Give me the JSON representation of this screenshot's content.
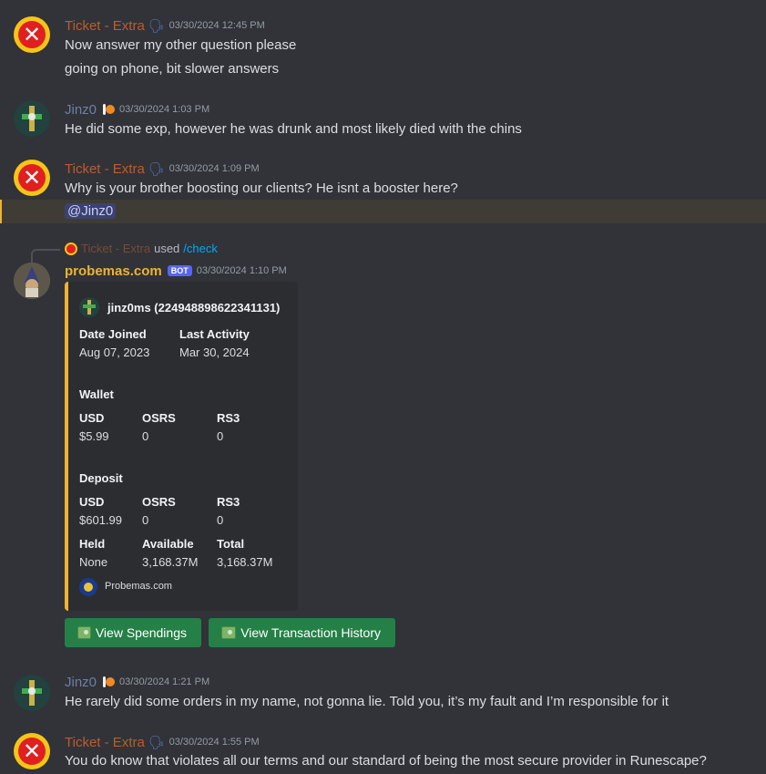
{
  "messages": [
    {
      "author": "Ticket - Extra",
      "timestamp": "03/30/2024 12:45 PM",
      "lines": [
        "Now answer my other question please",
        "going on phone, bit slower answers"
      ]
    },
    {
      "author": "Jinz0",
      "timestamp": "03/30/2024 1:03 PM",
      "lines": [
        "He did some exp, however he was drunk and most likely died with the chins"
      ]
    },
    {
      "author": "Ticket - Extra",
      "timestamp": "03/30/2024 1:09 PM",
      "lines": [
        "Why is your brother boosting our clients? He isnt a booster here?"
      ],
      "mention": "@Jinz0"
    },
    {
      "reply": {
        "user": "Ticket - Extra",
        "used": "used",
        "command": "/check"
      },
      "author": "probemas.com",
      "bot_tag": "BOT",
      "timestamp": "03/30/2024 1:10 PM",
      "embed": {
        "header": "jinz0ms (224948898622341131)",
        "date_joined_label": "Date Joined",
        "date_joined": "Aug 07, 2023",
        "last_activity_label": "Last Activity",
        "last_activity": "Mar 30, 2024",
        "wallet_title": "Wallet",
        "wallet": {
          "usd_label": "USD",
          "usd": "$5.99",
          "osrs_label": "OSRS",
          "osrs": "0",
          "rs3_label": "RS3",
          "rs3": "0"
        },
        "deposit_title": "Deposit",
        "deposit": {
          "usd_label": "USD",
          "usd": "$601.99",
          "osrs_label": "OSRS",
          "osrs": "0",
          "rs3_label": "RS3",
          "rs3": "0"
        },
        "held_label": "Held",
        "held": "None",
        "available_label": "Available",
        "available": "3,168.37M",
        "total_label": "Total",
        "total": "3,168.37M",
        "footer": "Probemas.com"
      },
      "buttons": [
        "View Spendings",
        "View Transaction History"
      ]
    },
    {
      "author": "Jinz0",
      "timestamp": "03/30/2024 1:21 PM",
      "lines": [
        "He rarely did some orders in my name, not gonna lie. Told you, it’s my fault and I’m responsible for it"
      ]
    },
    {
      "author": "Ticket - Extra",
      "timestamp": "03/30/2024 1:55 PM",
      "lines": [
        "You do know that violates all our terms and our standard of being the most secure provider in Runescape?"
      ]
    }
  ],
  "colors": {
    "background": "#313338",
    "ticket_name": "#c15a2a",
    "jinz_name": "#6f7ea8",
    "bot_name": "#f0b232",
    "button": "#248046",
    "mention_bg": "#3c4270",
    "highlight_bg": "#3f3c35"
  },
  "icons": [
    "x-avatar-icon",
    "jinz-avatar-icon",
    "speaking-head-icon",
    "bone-icon",
    "money-icon",
    "probemas-logo-icon"
  ]
}
